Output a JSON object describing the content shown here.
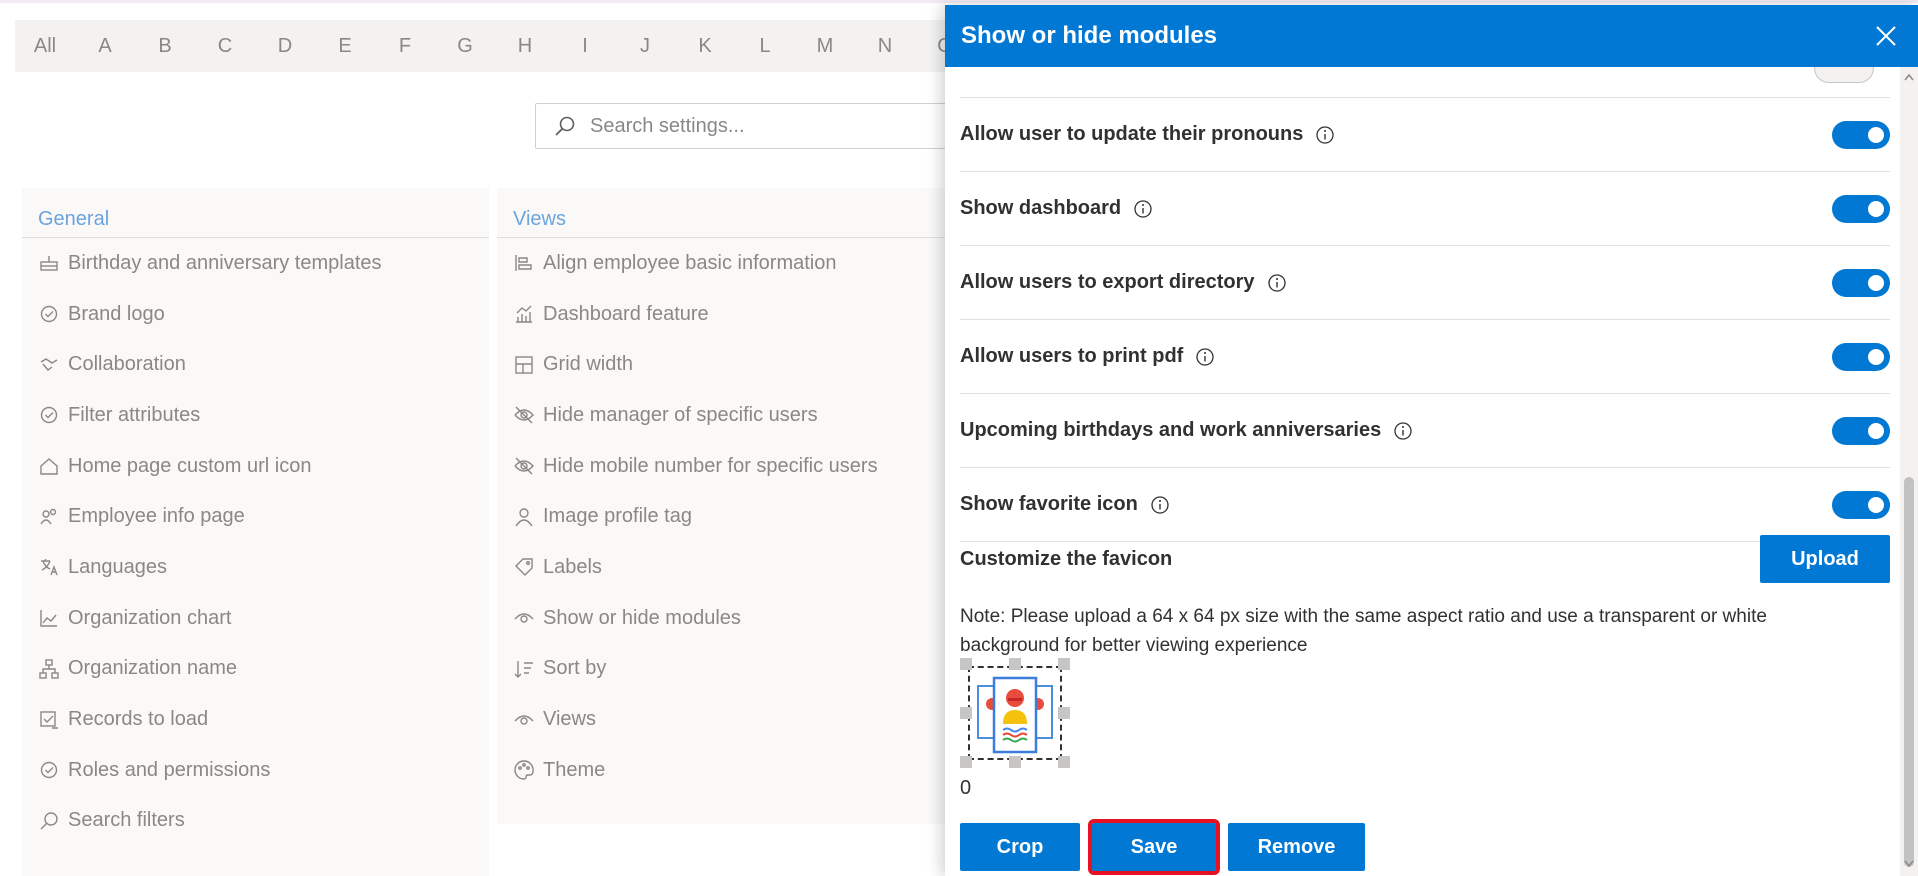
{
  "alphabet": [
    "All",
    "A",
    "B",
    "C",
    "D",
    "E",
    "F",
    "G",
    "H",
    "I",
    "J",
    "K",
    "L",
    "M",
    "N",
    "O"
  ],
  "search": {
    "placeholder": "Search settings..."
  },
  "general": {
    "header": "General",
    "items": [
      {
        "label": "Birthday and anniversary templates",
        "icon": "cake-icon"
      },
      {
        "label": "Brand logo",
        "icon": "badge-icon"
      },
      {
        "label": "Collaboration",
        "icon": "handshake-icon"
      },
      {
        "label": "Filter attributes",
        "icon": "badge-icon"
      },
      {
        "label": "Home page custom url icon",
        "icon": "home-icon"
      },
      {
        "label": "Employee info page",
        "icon": "people-icon"
      },
      {
        "label": "Languages",
        "icon": "translate-icon"
      },
      {
        "label": "Organization chart",
        "icon": "area-chart-icon"
      },
      {
        "label": "Organization name",
        "icon": "org-icon"
      },
      {
        "label": "Records to load",
        "icon": "checkbox-list-icon"
      },
      {
        "label": "Roles and permissions",
        "icon": "badge-icon"
      },
      {
        "label": "Search filters",
        "icon": "search-icon"
      }
    ]
  },
  "views": {
    "header": "Views",
    "items": [
      {
        "label": "Align employee basic information",
        "icon": "align-icon"
      },
      {
        "label": "Dashboard feature",
        "icon": "dashboard-chart-icon"
      },
      {
        "label": "Grid width",
        "icon": "grid-icon"
      },
      {
        "label": "Hide manager of specific users",
        "icon": "eye-hide-icon"
      },
      {
        "label": "Hide mobile number for specific users",
        "icon": "eye-hide-icon"
      },
      {
        "label": "Image profile tag",
        "icon": "person-icon"
      },
      {
        "label": "Labels",
        "icon": "tag-icon"
      },
      {
        "label": "Show or hide modules",
        "icon": "eye-icon"
      },
      {
        "label": "Sort by",
        "icon": "sort-icon"
      },
      {
        "label": "Views",
        "icon": "eye-icon"
      },
      {
        "label": "Theme",
        "icon": "palette-icon"
      }
    ]
  },
  "panel": {
    "title": "Show or hide modules",
    "toggles": [
      {
        "label": "Allow user to update their pronouns",
        "on": true
      },
      {
        "label": "Show dashboard",
        "on": true
      },
      {
        "label": "Allow users to export directory",
        "on": true
      },
      {
        "label": "Allow users to print pdf",
        "on": true
      },
      {
        "label": "Upcoming birthdays and work anniversaries",
        "on": true
      },
      {
        "label": "Show favorite icon",
        "on": true
      }
    ],
    "favicon_title": "Customize the favicon",
    "upload_label": "Upload",
    "note": "Note: Please upload a 64 x 64 px size with the same aspect ratio and use a transparent or white background for better viewing experience",
    "count": "0",
    "crop_label": "Crop",
    "save_label": "Save",
    "remove_label": "Remove"
  },
  "colors": {
    "accent": "#0078d4",
    "highlight": "#e81123",
    "muted_link": "#6aa4dc"
  }
}
